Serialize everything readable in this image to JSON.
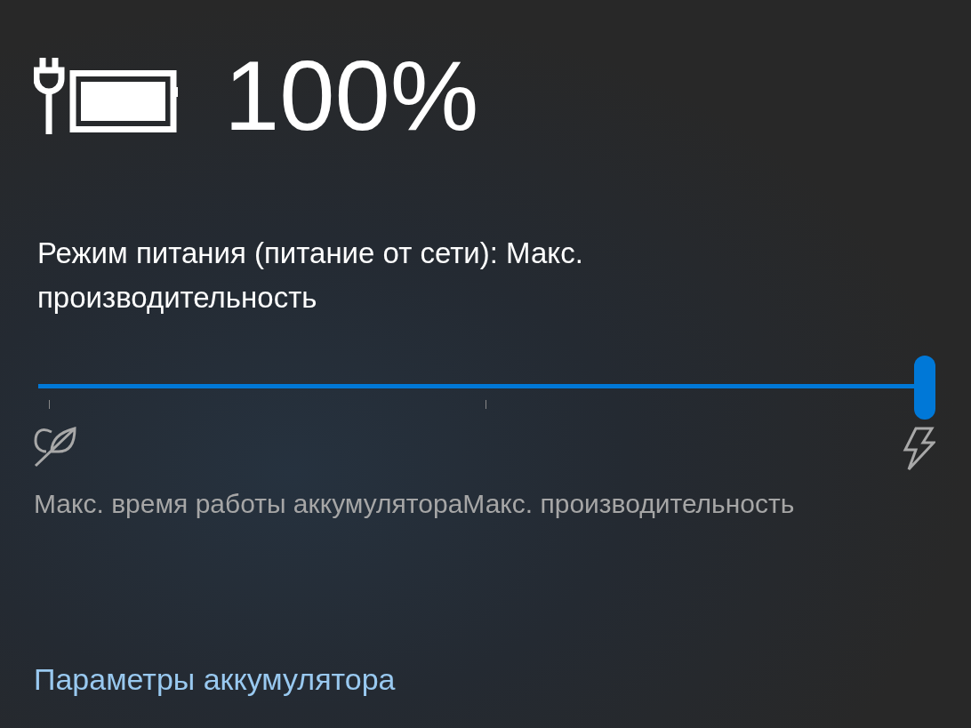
{
  "battery": {
    "percent": "100%",
    "charging": true
  },
  "power_mode": {
    "label": "Режим питания (питание от сети): Макс. производительность",
    "level": 1
  },
  "slider_labels": [
    "Макс. время работы аккумулятора",
    "Макс. производительность"
  ],
  "link": "Параметры аккумулятора"
}
